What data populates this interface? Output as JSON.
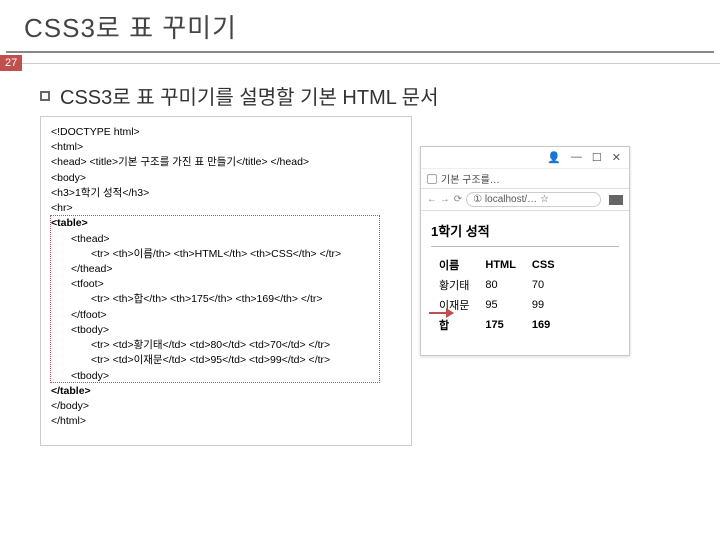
{
  "title": "CSS3로 표 꾸미기",
  "page_num": "27",
  "subtitle": "CSS3로 표 꾸미기를 설명할 기본 HTML 문서",
  "code": {
    "l0": "<!DOCTYPE html>",
    "l1": "<html>",
    "l2": "<head> <title>기본 구조를 가진 표 만들기</title> </head>",
    "l3": "<body>",
    "l4": "<h3>1학기 성적</h3>",
    "l5": "<hr>",
    "l6": "<table>",
    "l7": "<thead>",
    "l8": "<tr> <th>이름/th> <th>HTML</th> <th>CSS</th> </tr>",
    "l9": "</thead>",
    "l10": "<tfoot>",
    "l11": "<tr> <th>합</th> <th>175</th> <th>169</th> </tr>",
    "l12": "</tfoot>",
    "l13": "<tbody>",
    "l14": "<tr> <td>황기태</td> <td>80</td> <td>70</td> </tr>",
    "l15": "<tr> <td>이재문</td> <td>95</td> <td>99</td> </tr>",
    "l16": "<tbody>",
    "l17": "</table>",
    "l18": "</body>",
    "l19": "</html>"
  },
  "browser": {
    "win": {
      "min": "—",
      "max": "☐",
      "close": "✕"
    },
    "tab_title": "기본 구조를…",
    "url_arrows": "← →",
    "url_reload": "⟳",
    "url_text": "① localhost/… ☆",
    "page_heading": "1학기 성적",
    "table": {
      "headers": [
        "이름",
        "HTML",
        "CSS"
      ],
      "rows": [
        [
          "황기태",
          "80",
          "70"
        ],
        [
          "이재문",
          "95",
          "99"
        ]
      ],
      "footer": [
        "합",
        "175",
        "169"
      ]
    }
  },
  "chart_data": {
    "type": "table",
    "title": "1학기 성적",
    "columns": [
      "이름",
      "HTML",
      "CSS"
    ],
    "rows": [
      {
        "이름": "황기태",
        "HTML": 80,
        "CSS": 70
      },
      {
        "이름": "이재문",
        "HTML": 95,
        "CSS": 99
      }
    ],
    "footer": {
      "이름": "합",
      "HTML": 175,
      "CSS": 169
    }
  }
}
